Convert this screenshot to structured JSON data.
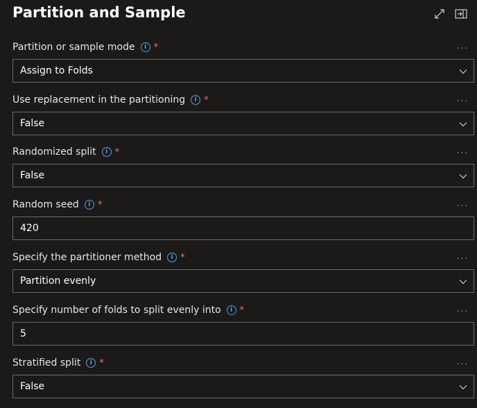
{
  "panel": {
    "title": "Partition and Sample"
  },
  "fields": [
    {
      "label": "Partition or sample mode",
      "value": "Assign to Folds",
      "type": "dropdown"
    },
    {
      "label": "Use replacement in the partitioning",
      "value": "False",
      "type": "dropdown"
    },
    {
      "label": "Randomized split",
      "value": "False",
      "type": "dropdown"
    },
    {
      "label": "Random seed",
      "value": "420",
      "type": "input"
    },
    {
      "label": "Specify the partitioner method",
      "value": "Partition evenly",
      "type": "dropdown"
    },
    {
      "label": "Specify number of folds to split evenly into",
      "value": "5",
      "type": "input"
    },
    {
      "label": "Stratified split",
      "value": "False",
      "type": "dropdown"
    }
  ],
  "common": {
    "required_mark": "*",
    "info_glyph": "i",
    "more_glyph": "···"
  },
  "icons": {
    "expand": "expand-icon",
    "collapse_panel": "collapse-panel-icon",
    "info": "info-icon",
    "more": "more-icon",
    "chevron": "chevron-down-icon"
  },
  "colors": {
    "background": "#1b1a19",
    "info_accent": "#4fa3e0",
    "required": "#ff6b6b",
    "border": "#6b6b6b"
  }
}
